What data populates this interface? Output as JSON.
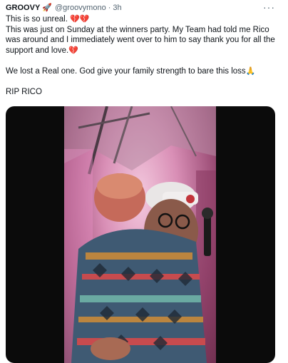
{
  "author": {
    "name": "GROOVY",
    "badge_icon": "rocket-icon",
    "handle": "@groovymono",
    "separator": "·",
    "time": "3h"
  },
  "menu": {
    "more_label": "···"
  },
  "tweet": {
    "line1": "This is so unreal.",
    "line2": "This was just on Sunday at the winners party. My Team had told me Rico was around and I immediately went over to him to say thank you for all the support and love.",
    "line3": "We lost a Real one. God give your family strength to bare this loss",
    "line4": "RIP RICO"
  },
  "emojis": {
    "broken_heart": "💔",
    "pray": "🙏"
  },
  "colors": {
    "text": "#0f1419",
    "secondary": "#536471",
    "accent_pink": "#e0245e"
  }
}
